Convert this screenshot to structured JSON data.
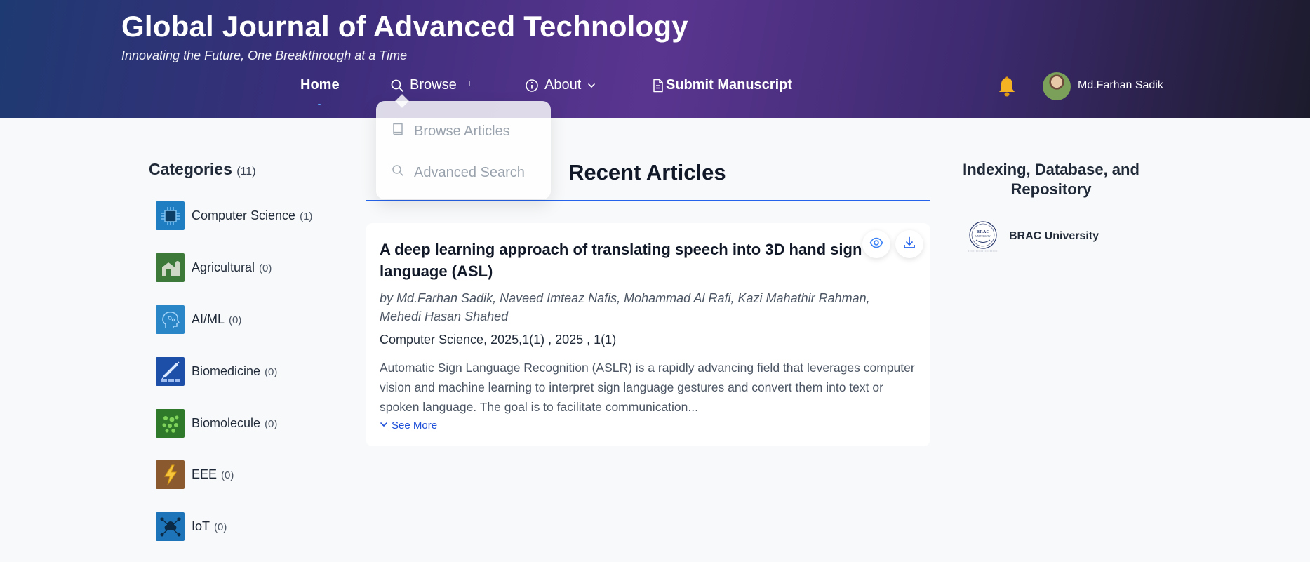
{
  "header": {
    "title": "Global Journal of Advanced Technology",
    "tagline": "Innovating the Future, One Breakthrough at a Time",
    "nav": {
      "home": "Home",
      "browse": "Browse",
      "browse_caret": "└",
      "about": "About",
      "submit": "Submit Manuscript"
    },
    "user_name": "Md.Farhan Sadik",
    "icons": [
      "search-icon",
      "info-icon",
      "document-icon",
      "bell-icon",
      "chevron-down-icon"
    ]
  },
  "browse_dropdown": {
    "items": [
      {
        "label": "Browse Articles",
        "icon": "book-icon"
      },
      {
        "label": "Advanced Search",
        "icon": "search-icon"
      }
    ]
  },
  "categories": {
    "title": "Categories",
    "count": "(11)",
    "items": [
      {
        "label": "Computer Science",
        "count": "(1)",
        "icon": "chip-icon",
        "color": "#1f7ec1"
      },
      {
        "label": "Agricultural",
        "count": "(0)",
        "icon": "barn-icon",
        "color": "#3d7a3a"
      },
      {
        "label": "AI/ML",
        "count": "(0)",
        "icon": "brain-icon",
        "color": "#2b86c7"
      },
      {
        "label": "Biomedicine",
        "count": "(0)",
        "icon": "syringe-icon",
        "color": "#1d4fa8"
      },
      {
        "label": "Biomolecule",
        "count": "(0)",
        "icon": "molecule-icon",
        "color": "#2f7a2a"
      },
      {
        "label": "EEE",
        "count": "(0)",
        "icon": "lightning-icon",
        "color": "#8a5a2e"
      },
      {
        "label": "IoT",
        "count": "(0)",
        "icon": "cloud-network-icon",
        "color": "#1e74b8"
      }
    ]
  },
  "main": {
    "section_title": "Recent Articles",
    "article": {
      "title": "A deep learning approach of translating speech into 3D hand sign language (ASL)",
      "authors": "by Md.Farhan Sadik, Naveed Imteaz Nafis, Mohammad Al Rafi, Kazi Mahathir Rahman, Mehedi Hasan Shahed",
      "meta": "Computer Science, 2025,1(1) , 2025 , 1(1)",
      "abstract": "Automatic Sign Language Recognition (ASLR) is a rapidly advancing field that leverages computer vision and machine learning to interpret sign language gestures and convert them into text or spoken language. The goal is to facilitate communication...",
      "see_more": "See More"
    }
  },
  "indexing": {
    "title": "Indexing, Database, and Repository",
    "items": [
      {
        "label": "BRAC University",
        "logo_text": "BRAC UNIVERSITY"
      }
    ]
  },
  "colors": {
    "accent": "#2563eb",
    "header_start": "#1e3a72",
    "header_mid": "#5a3590",
    "header_end": "#1c1b2c",
    "bell": "#f5b324"
  }
}
